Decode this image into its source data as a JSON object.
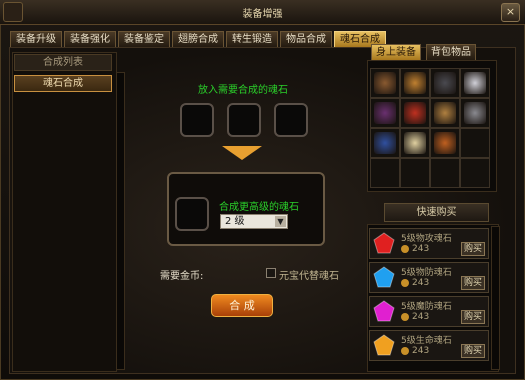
{
  "window": {
    "title": "装备增强",
    "close_label": "×"
  },
  "tabs": [
    "装备升级",
    "装备强化",
    "装备鉴定",
    "翅膀合成",
    "转生锻造",
    "物品合成",
    "魂石合成"
  ],
  "left_list": {
    "header": "合成列表",
    "items": [
      "魂石合成"
    ]
  },
  "center": {
    "hint": "放入需要合成的魂石",
    "result_label": "合成更高级的魂石",
    "level_select": "2 级",
    "gold_label": "需要金币:",
    "checkbox_label": "元宝代替魂石",
    "combine_button": "合 成"
  },
  "right_tabs": [
    "身上装备",
    "背包物品"
  ],
  "quick_buy": "快速购买",
  "shop_items": [
    {
      "name": "5级物攻魂石",
      "price": "243",
      "buy": "购买",
      "color": "#e02020"
    },
    {
      "name": "5级物防魂石",
      "price": "243",
      "buy": "购买",
      "color": "#20a0f0"
    },
    {
      "name": "5级魔防魂石",
      "price": "243",
      "buy": "购买",
      "color": "#e020d0"
    },
    {
      "name": "5级生命魂石",
      "price": "243",
      "buy": "购买",
      "color": "#f0a020"
    }
  ],
  "equip_colors": [
    "#8a5a30",
    "#c08030",
    "#4a4a50",
    "#d0d0d8",
    "#6a3070",
    "#c03020",
    "#b08040",
    "#8a8a90",
    "#3050a0",
    "#e0d0a0",
    "#c06020"
  ]
}
